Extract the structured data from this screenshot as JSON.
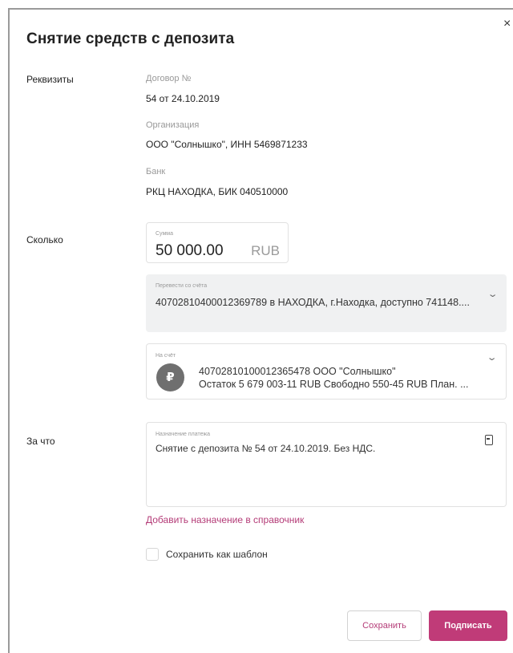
{
  "dialog": {
    "title": "Снятие средств с депозита",
    "close_glyph": "×"
  },
  "sections": {
    "requisites": "Реквизиты",
    "how_much": "Сколько",
    "purpose": "За что"
  },
  "requisites": {
    "contract_label": "Договор №",
    "contract_value": "54 от 24.10.2019",
    "organization_label": "Организация",
    "organization_value": "ООО \"Солнышко\", ИНН 5469871233",
    "bank_label": "Банк",
    "bank_value": "РКЦ НАХОДКА, БИК 040510000"
  },
  "amount": {
    "label": "Сумма",
    "value": "50 000.00",
    "currency": "RUB"
  },
  "from_account": {
    "label": "Перевести со счёта",
    "value": "40702810400012369789 в НАХОДКА, г.Находка, доступно 741148...."
  },
  "to_account": {
    "label": "На счёт",
    "currency_icon": "₽",
    "line1": "40702810100012365478 ООО \"Солнышко\"",
    "line2": "Остаток 5 679 003-11 RUB Свободно 550-45 RUB  План. ..."
  },
  "payment_purpose": {
    "label": "Назначение платежа",
    "value": "Снятие с депозита № 54 от 24.10.2019. Без НДС."
  },
  "add_to_directory_link": "Добавить назначение в справочник",
  "save_template": {
    "label": "Сохранить как шаблон",
    "checked": false
  },
  "buttons": {
    "save": "Сохранить",
    "sign": "Подписать"
  },
  "icons": {
    "dropdown": "chevron-down-icon",
    "directory": "book-icon",
    "currency": "ruble-icon",
    "close": "close-icon"
  },
  "colors": {
    "accent": "#c03b78",
    "link": "#b43b77",
    "from_box_bg": "#f0f1f2"
  }
}
